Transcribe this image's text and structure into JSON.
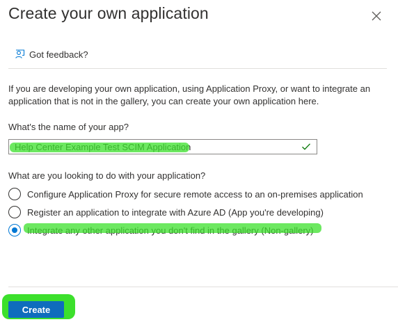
{
  "header": {
    "title": "Create your own application",
    "close_icon": "close-icon"
  },
  "feedback": {
    "icon": "feedback-person-icon",
    "label": "Got feedback?"
  },
  "intro": {
    "text": "If you are developing your own application, using Application Proxy, or want to integrate an application that is not in the gallery, you can create your own application here."
  },
  "form": {
    "name_label": "What's the name of your app?",
    "name_value": "Help Center Example Test SCIM Application",
    "name_valid_icon": "checkmark-icon",
    "purpose_label": "What are you looking to do with your application?",
    "options": [
      {
        "label": "Configure Application Proxy for secure remote access to an on-premises application",
        "selected": false
      },
      {
        "label": "Register an application to integrate with Azure AD (App you're developing)",
        "selected": false
      },
      {
        "label": "Integrate any other application you don't find in the gallery (Non-gallery)",
        "selected": true
      }
    ]
  },
  "footer": {
    "create_label": "Create"
  },
  "colors": {
    "accent": "#0078d4",
    "button": "#0f6cbd",
    "highlight": "#3ce02c",
    "text": "#323130",
    "border": "#8a8886"
  }
}
